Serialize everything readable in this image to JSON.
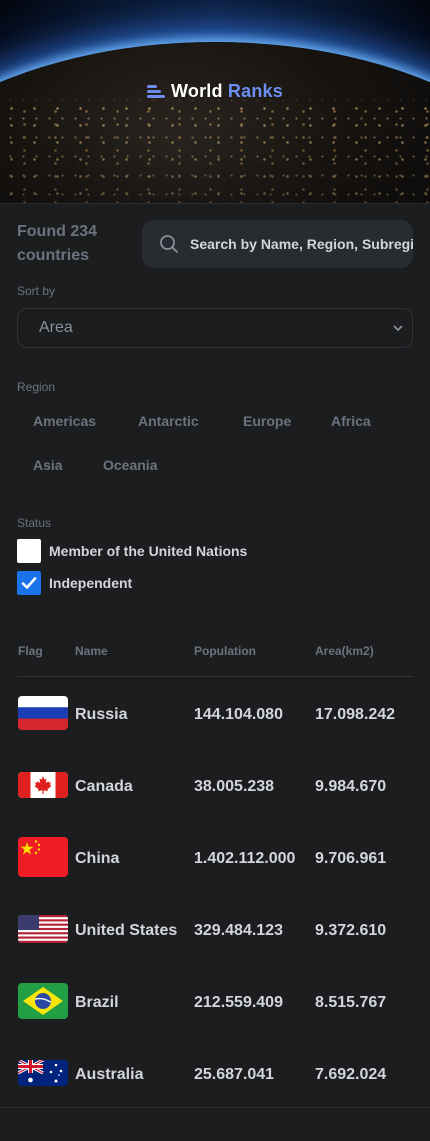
{
  "header": {
    "logo_icon": "bars-icon",
    "brand_first": "World",
    "brand_second": "Ranks",
    "brand_accent_color": "#6d8ff3"
  },
  "summary": {
    "found_text": "Found 234 countries"
  },
  "search": {
    "icon": "search-icon",
    "value": "Search by Name, Region, Subregion"
  },
  "sort": {
    "label": "Sort by",
    "selected": "Area"
  },
  "region": {
    "label": "Region",
    "options": [
      "Americas",
      "Antarctic",
      "Europe",
      "Africa",
      "Asia",
      "Oceania"
    ]
  },
  "status": {
    "label": "Status",
    "options": [
      {
        "label": "Member of the United Nations",
        "checked": false
      },
      {
        "label": "Independent",
        "checked": true
      }
    ]
  },
  "table": {
    "headers": {
      "flag": "Flag",
      "name": "Name",
      "population": "Population",
      "area": "Area(km2)"
    },
    "rows": [
      {
        "flag": "russia-flag",
        "name": "Russia",
        "population": "144.104.080",
        "area": "17.098.242"
      },
      {
        "flag": "canada-flag",
        "name": "Canada",
        "population": "38.005.238",
        "area": "9.984.670"
      },
      {
        "flag": "china-flag",
        "name": "China",
        "population": "1.402.112.000",
        "area": "9.706.961"
      },
      {
        "flag": "usa-flag",
        "name": "United States",
        "population": "329.484.123",
        "area": "9.372.610"
      },
      {
        "flag": "brazil-flag",
        "name": "Brazil",
        "population": "212.559.409",
        "area": "8.515.767"
      },
      {
        "flag": "australia-flag",
        "name": "Australia",
        "population": "25.687.041",
        "area": "7.692.024"
      }
    ]
  }
}
